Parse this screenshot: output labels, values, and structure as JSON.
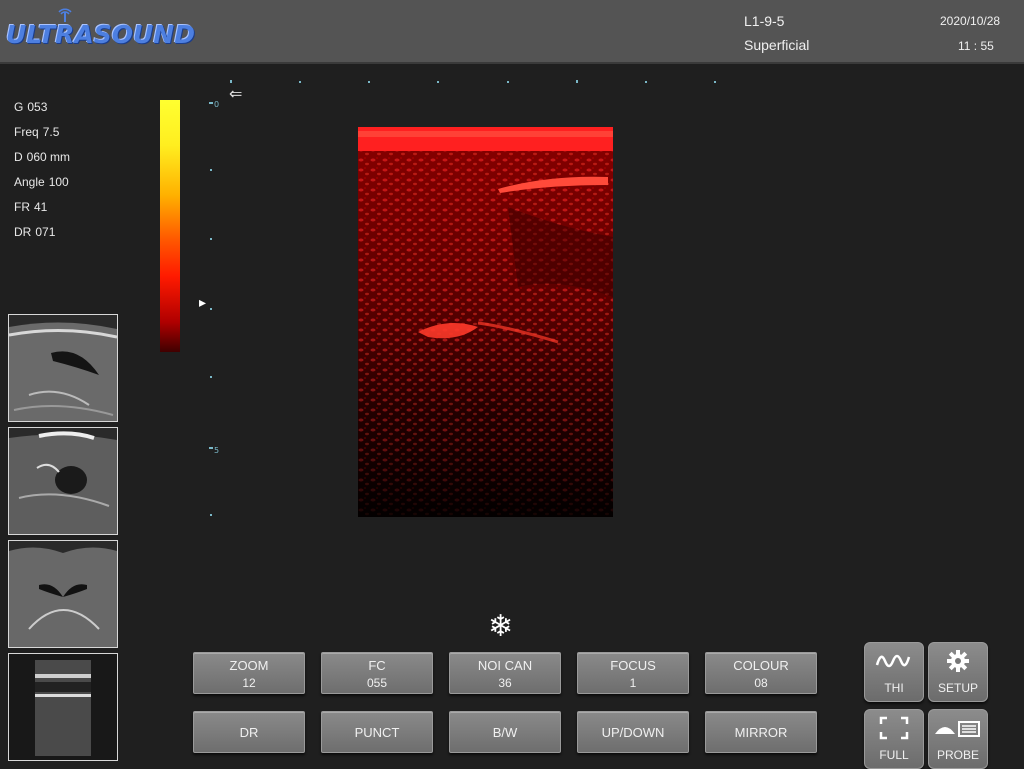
{
  "header": {
    "logo_text": "ULTRASOUND",
    "probe": "L1-9-5",
    "preset": "Superficial",
    "date": "2020/10/28",
    "time": "11 : 55"
  },
  "params": [
    {
      "label": "G",
      "value": "053"
    },
    {
      "label": "Freq",
      "value": "7.5"
    },
    {
      "label": "D",
      "value": "060 mm"
    },
    {
      "label": "Angle",
      "value": "100"
    },
    {
      "label": "FR",
      "value": "41"
    },
    {
      "label": "DR",
      "value": "071"
    }
  ],
  "depth_scale": {
    "top_label": "0",
    "mid_label": "5"
  },
  "controls": {
    "row1": [
      {
        "label": "ZOOM",
        "value": "12"
      },
      {
        "label": "FC",
        "value": "055"
      },
      {
        "label": "NOI CAN",
        "value": "36"
      },
      {
        "label": "FOCUS",
        "value": "1"
      },
      {
        "label": "COLOUR",
        "value": "08"
      }
    ],
    "row2": [
      {
        "label": "DR"
      },
      {
        "label": "PUNCT"
      },
      {
        "label": "B/W"
      },
      {
        "label": "UP/DOWN"
      },
      {
        "label": "MIRROR"
      }
    ]
  },
  "side_buttons": {
    "thi": "THI",
    "setup": "SETUP",
    "full": "FULL",
    "probe": "PROBE"
  },
  "icons": {
    "freeze": "snowflake-icon",
    "thi": "wave-icon",
    "setup": "gear-icon",
    "full": "fullscreen-icon",
    "probe": "probe-icon"
  },
  "colors": {
    "topbar": "#545454",
    "background": "#1f1f1f",
    "logo": "#4d7fe0",
    "image_tint": "#ff1a1a"
  }
}
